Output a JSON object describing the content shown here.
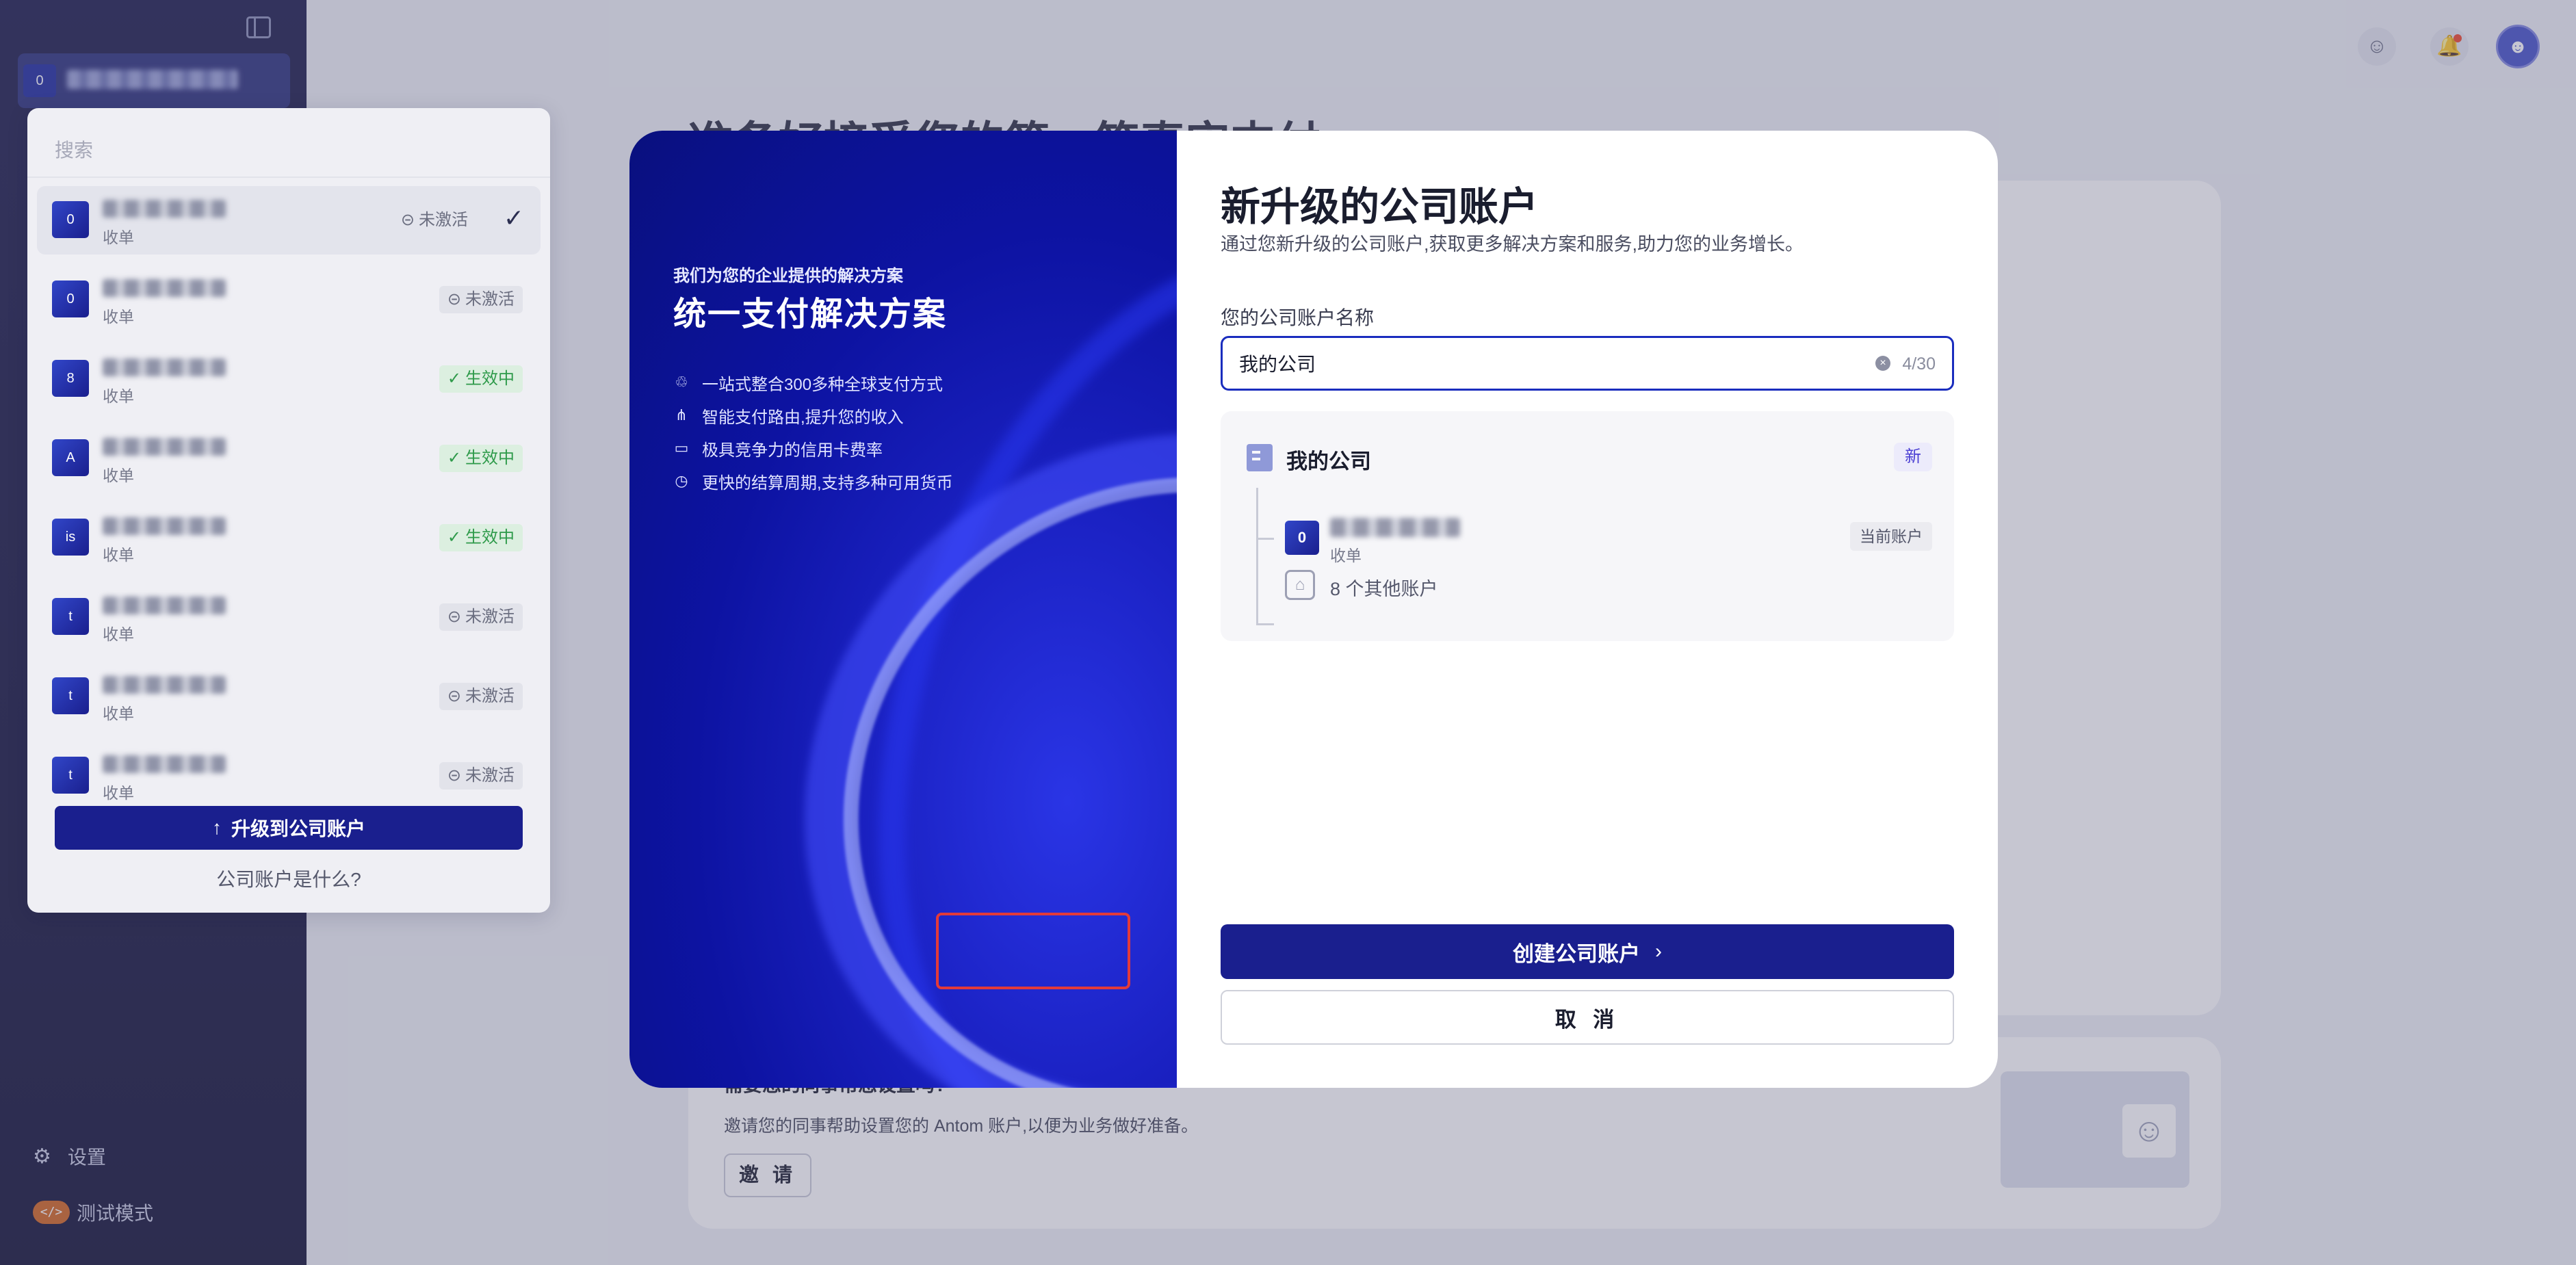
{
  "app": {
    "page_title": "准备好接受您的第一笔真实支付",
    "sidebar": {
      "current_account_initial": "0",
      "settings_label": "设置",
      "test_mode_label": "测试模式",
      "test_mode_badge": "</>"
    },
    "topbar": {
      "avatar_glyph": "☻",
      "feedback_glyph": "☺",
      "notifications_glyph": "🔔"
    },
    "invite_card": {
      "title": "需要您的同事帮您设置吗?",
      "description": "邀请您的同事帮助设置您的 Antom 账户,以便为业务做好准备。",
      "button_label": "邀 请"
    }
  },
  "account_dropdown": {
    "search_placeholder": "搜索",
    "accounts": [
      {
        "initial": "0",
        "type": "收单",
        "status": "未激活",
        "status_kind": "inactive",
        "selected": true
      },
      {
        "initial": "0",
        "type": "收单",
        "status": "未激活",
        "status_kind": "inactive",
        "selected": false
      },
      {
        "initial": "8",
        "type": "收单",
        "status": "生效中",
        "status_kind": "active",
        "selected": false
      },
      {
        "initial": "A",
        "type": "收单",
        "status": "生效中",
        "status_kind": "active",
        "selected": false
      },
      {
        "initial": "is",
        "type": "收单",
        "status": "生效中",
        "status_kind": "active",
        "selected": false
      },
      {
        "initial": "t",
        "type": "收单",
        "status": "未激活",
        "status_kind": "inactive",
        "selected": false
      },
      {
        "initial": "t",
        "type": "收单",
        "status": "未激活",
        "status_kind": "inactive",
        "selected": false
      },
      {
        "initial": "t",
        "type": "收单",
        "status": "未激活",
        "status_kind": "inactive",
        "selected": false
      }
    ],
    "upgrade_button": "升级到公司账户",
    "what_is_link": "公司账户是什么?"
  },
  "modal": {
    "left": {
      "kicker": "我们为您的企业提供的解决方案",
      "title": "统一支付解决方案",
      "features": [
        {
          "icon": "♲",
          "text": "一站式整合300多种全球支付方式"
        },
        {
          "icon": "⋔",
          "text": "智能支付路由,提升您的收入"
        },
        {
          "icon": "▭",
          "text": "极具竞争力的信用卡费率"
        },
        {
          "icon": "◷",
          "text": "更快的结算周期,支持多种可用货币"
        }
      ]
    },
    "right": {
      "title": "新升级的公司账户",
      "subtitle": "通过您新升级的公司账户,获取更多解决方案和服务,助力您的业务增长。",
      "name_label": "您的公司账户名称",
      "name_value": "我的公司",
      "char_count": "4/30",
      "preview": {
        "company_name": "我的公司",
        "new_badge": "新",
        "current_account_initial": "0",
        "current_account_type": "收单",
        "current_account_tag": "当前账户",
        "others_text": "8 个其他账户"
      },
      "create_button": "创建公司账户",
      "cancel_button": "取 消"
    }
  }
}
